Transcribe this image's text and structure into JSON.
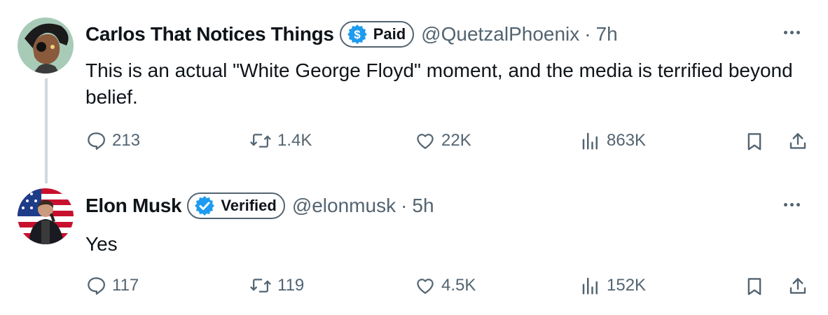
{
  "posts": [
    {
      "author": {
        "name": "Carlos That Notices Things",
        "badge": "Paid",
        "badge_icon": "dollar-icon",
        "handle": "@QuetzalPhoenix",
        "time": "7h"
      },
      "text": "This is an actual \"White George Floyd\" moment, and the media is terrified beyond belief.",
      "stats": {
        "replies": "213",
        "reposts": "1.4K",
        "likes": "22K",
        "views": "863K"
      }
    },
    {
      "author": {
        "name": "Elon Musk",
        "badge": "Verified",
        "badge_icon": "verified-check-icon",
        "handle": "@elonmusk",
        "time": "5h"
      },
      "text": "Yes",
      "stats": {
        "replies": "117",
        "reposts": "119",
        "likes": "4.5K",
        "views": "152K"
      }
    }
  ],
  "separator": "·",
  "colors": {
    "text": "#0f1419",
    "muted": "#536471",
    "accent": "#1d9bf0",
    "thread_line": "#cfd9de"
  }
}
